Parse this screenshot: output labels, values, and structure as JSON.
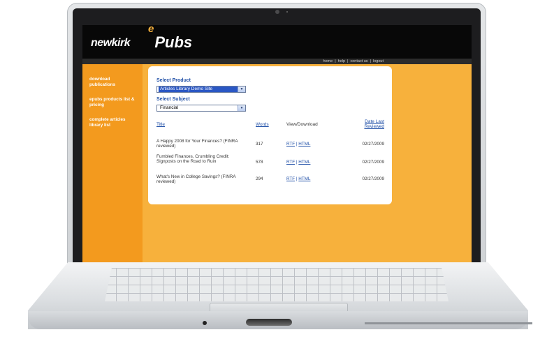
{
  "header": {
    "brand": "newkirk",
    "product_prefix": "e",
    "product_name": "Pubs"
  },
  "topnav": {
    "links": [
      "home",
      "help",
      "contact us",
      "logout"
    ],
    "separator": "|"
  },
  "sidebar": {
    "items": [
      {
        "label": "download publications"
      },
      {
        "label": "epubs products list & pricing"
      },
      {
        "label": "complete articles library list"
      }
    ]
  },
  "form": {
    "product_label": "Select Product",
    "product_value": "Articles Library Demo Site",
    "subject_label": "Select Subject",
    "subject_value": "Financial"
  },
  "table": {
    "columns": {
      "title": "Title",
      "words": "Words",
      "view": "View/Download",
      "date": "Date Last Reviewed"
    },
    "rows": [
      {
        "title": "A Happy 2008 for Your Finances? (FINRA reviewed)",
        "words": "317",
        "rtf": "RTF",
        "sep": "|",
        "html": "HTML",
        "date": "02/27/2009"
      },
      {
        "title": "Fumbled Finances, Crumbling Credit: Signposts on the Road to Ruin",
        "words": "578",
        "rtf": "RTF",
        "sep": "|",
        "html": "HTML",
        "date": "02/27/2009"
      },
      {
        "title": "What's New in College Savings? (FINRA reviewed)",
        "words": "294",
        "rtf": "RTF",
        "sep": "|",
        "html": "HTML",
        "date": "02/27/2009"
      }
    ]
  },
  "colors": {
    "page_bg": "#f7b13c",
    "sidebar_bg": "#f39a1e",
    "header_bg": "#080808",
    "link": "#1f4fa7"
  }
}
